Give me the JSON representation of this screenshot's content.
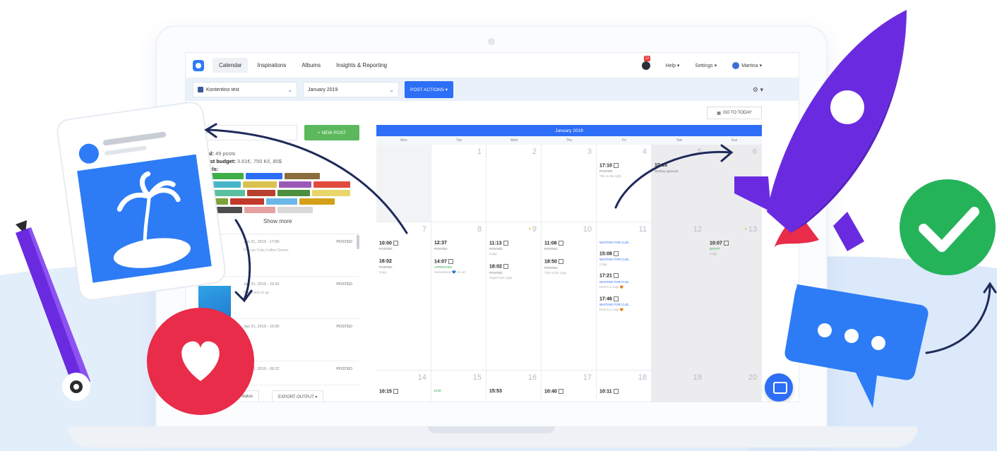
{
  "nav": {
    "tabs": [
      "Calendar",
      "Inspirations",
      "Albums",
      "Insights & Reporting"
    ],
    "notification_count": "12",
    "help": "Help ▾",
    "settings": "Settings ▾",
    "user": "Martina ▾"
  },
  "toolbar": {
    "page_select": "Kontentino test",
    "month_select": "January 2019",
    "post_actions": "POST ACTIONS ▾",
    "gear": "⚙ ▾"
  },
  "left": {
    "search_placeholder": "Fi",
    "new_post": "+ NEW POST",
    "total_label": "Total:",
    "total_value": "49 posts",
    "boost_label": "Boost budget:",
    "boost_value": "3.61€, 750 Kč, 80$",
    "labels_label": "Labels:",
    "show_more": "Show more",
    "posts": [
      {
        "date": "Jan 31, 2019 - 17:00",
        "status": "POSTED",
        "desc": "Pre vas Coke Coffee Cheers"
      },
      {
        "date": "Jan 31, 2019 - 10:33",
        "status": "POSTED",
        "desc": "Happiness to go"
      },
      {
        "date": "Jan 31, 2019 - 10:00",
        "status": "POSTED",
        "desc": ""
      },
      {
        "date": "Jan 31, 2019 - 09:22",
        "status": "POSTED",
        "desc": ""
      }
    ],
    "status_filter": "status",
    "export": "EXPORT OUTPUT ▾"
  },
  "calendar": {
    "goto_today": "GO TO TODAY",
    "month": "January 2019",
    "weekdays": [
      "Mon",
      "Tue",
      "Wed",
      "Thu",
      "Fri",
      "Sat",
      "Sun"
    ],
    "row1": [
      "",
      "1",
      "2",
      "3",
      "4",
      "5",
      "6"
    ],
    "row2": [
      "7",
      "8",
      "9",
      "10",
      "11",
      "12",
      "13"
    ],
    "row3": [
      "14",
      "15",
      "16",
      "17",
      "18",
      "19",
      "20"
    ],
    "events": {
      "fri4_time": "17:10",
      "fri4_st": "POSTED",
      "fri4_sub": "This is the right",
      "sat5_time": "10:33",
      "sat5_st": "Waiting approval",
      "mon7_t1": "10:00",
      "mon7_s1": "POSTED",
      "mon7_t2": "16:02",
      "mon7_s2": "POSTED",
      "mon7_sub": "Copy",
      "tue8_t1": "12:37",
      "tue8_s1": "POSTED",
      "tue8_t2": "14:07",
      "tue8_s2": "APPROVED",
      "tue8_sub": "Somewhere 💙 it's art",
      "wed9_t1": "11:13",
      "wed9_s1": "POSTED",
      "wed9_sub": "Copy",
      "wed9_t2": "18:02",
      "wed9_s2": "POSTED",
      "wed9_sub2": "Super love copy",
      "thu10_t1": "11:08",
      "thu10_s1": "POSTED",
      "thu10_t2": "18:50",
      "thu10_s2": "POSTED",
      "thu10_sub": "This is the copy",
      "fri11_w1": "WAITING FOR CLIE...",
      "fri11_t1": "15:08",
      "fri11_w2": "WAITING FOR CLIE...",
      "fri11_sub1": "Copy",
      "fri11_t2": "17:21",
      "fri11_w3": "WAITING FOR CLIE...",
      "fri11_sub2": "Here's a copy 😍",
      "fri11_t3": "17:46",
      "fri11_w4": "WAITING FOR CLIE...",
      "fri11_sub3": "Here's a copy 😍",
      "sun13_t": "10:07",
      "sun13_s": "DRAFT",
      "sun13_sub": "Copy",
      "mon14_t": "10:15",
      "tue15_s": "Draft",
      "wed16_t": "15:53",
      "thu17_t": "10:40",
      "fri18_t": "10:11"
    }
  },
  "label_colors": [
    "#3fae49",
    "#2d6ef6",
    "#8a6d3b",
    "#47b5c9",
    "#d9c24f",
    "#9b59b6",
    "#e04b3c",
    "#5bc0a0",
    "#b7412e",
    "#4c8f3f",
    "#e8d66b",
    "#7fa13a",
    "#c0392b",
    "#6ab7e8",
    "#d4a017",
    "#4d4d4d",
    "#e5a0a0",
    "#d9d9d9"
  ]
}
